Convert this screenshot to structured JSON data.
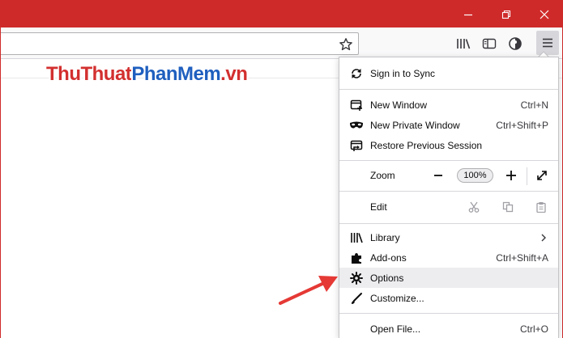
{
  "colors": {
    "titlebar": "#cf2a2a",
    "arrow": "#e53935",
    "hover": "#ededf0"
  },
  "watermark": {
    "part1": "ThuThuat",
    "part2": "PhanMem",
    "part3": ".vn"
  },
  "menu": {
    "sign_in": "Sign in to Sync",
    "new_window": {
      "label": "New Window",
      "shortcut": "Ctrl+N"
    },
    "private_window": {
      "label": "New Private Window",
      "shortcut": "Ctrl+Shift+P"
    },
    "restore_session": "Restore Previous Session",
    "zoom": {
      "label": "Zoom",
      "value": "100%"
    },
    "edit": "Edit",
    "library": "Library",
    "addons": {
      "label": "Add-ons",
      "shortcut": "Ctrl+Shift+A"
    },
    "options": "Options",
    "customize": "Customize...",
    "open_file": {
      "label": "Open File...",
      "shortcut": "Ctrl+O"
    }
  },
  "icons": {
    "minimize": "minimize-icon",
    "restore": "restore-icon",
    "close": "close-icon",
    "star": "star-icon",
    "library": "library-icon",
    "sidebar": "sidebar-icon",
    "account": "account-icon",
    "menu": "hamburger-menu-icon"
  }
}
